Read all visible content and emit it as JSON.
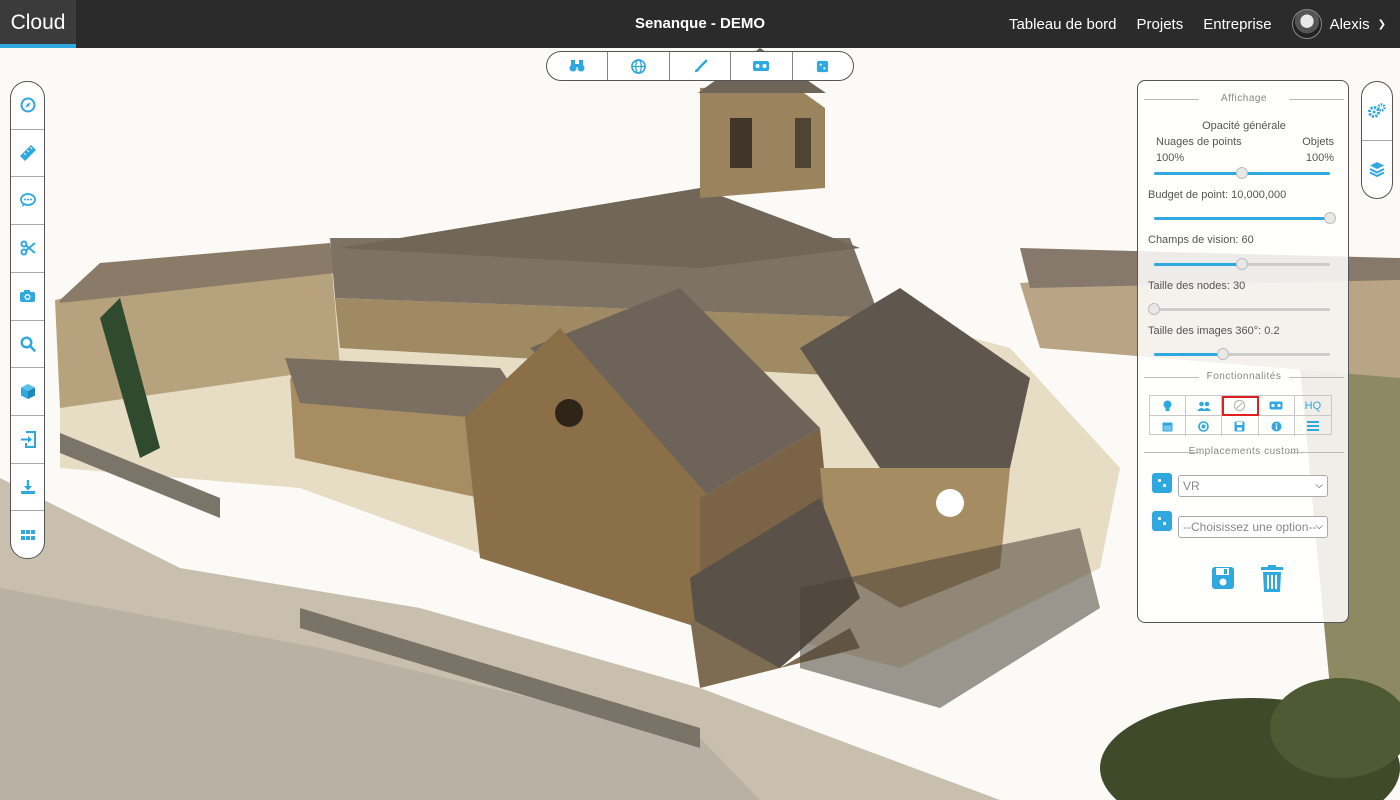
{
  "navbar": {
    "brand": "Cloud",
    "title": "Senanque - DEMO",
    "links": [
      "Tableau de bord",
      "Projets",
      "Entreprise"
    ],
    "user_name": "Alexis"
  },
  "top_toolbar": {
    "icons": [
      "binoculars-icon",
      "globe-icon",
      "brush-icon",
      "vr-headset-icon",
      "cube-face-icon"
    ]
  },
  "left_toolbar": {
    "icons": [
      "compass-icon",
      "ruler-icon",
      "comment-icon",
      "scissors-icon",
      "camera-icon",
      "search-icon",
      "cube-icon",
      "import-icon",
      "download-icon",
      "grid-icon"
    ]
  },
  "right_toolbar": {
    "icons": [
      "gears-icon",
      "layers-icon"
    ]
  },
  "panel": {
    "display_title": "Affichage",
    "opacity_label": "Opacité générale",
    "point_clouds_label": "Nuages de points",
    "objects_label": "Objets",
    "point_clouds_value": "100%",
    "objects_value": "100%",
    "opacity_balance": 0.5,
    "point_budget_label": "Budget de point: 10,000,000",
    "point_budget_level": 1.0,
    "fov_label": "Champs de vision: 60",
    "fov_level": 0.5,
    "node_size_label": "Taille des nodes: 30",
    "node_size_level": 0.0,
    "image_size_label": "Taille des images 360°: 0.2",
    "image_size_level": 0.39,
    "features_title": "Fonctionnalités",
    "feature_icons": [
      "lightbulb-icon",
      "users-icon",
      "compass-tool-icon",
      "vr-icon",
      "hq-icon",
      "calendar-icon",
      "target-icon",
      "save-icon",
      "info-icon",
      "list-icon"
    ],
    "hq_label": "HQ",
    "custom_title": "Emplacements custom",
    "location_select_value": "VR",
    "option_select_value": "--Choisissez une option--"
  },
  "colors": {
    "accent": "#2fa8e0",
    "navbar_bg": "#2b2b2b",
    "highlight": "#e02020"
  }
}
